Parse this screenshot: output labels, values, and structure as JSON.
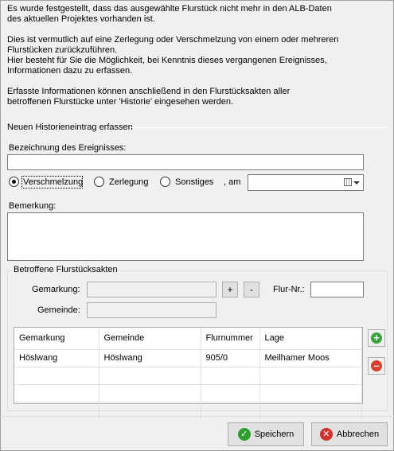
{
  "intro": {
    "paragraph1": "Es wurde festgestellt, dass das ausgewählte Flurstück nicht mehr in den ALB-Daten\ndes aktuellen Projektes vorhanden ist.",
    "paragraph2": "Dies ist vermutlich auf eine Zerlegung oder Verschmelzung von einem oder mehreren\nFlurstücken zurückzuführen.\nHier besteht für Sie die Möglichkeit, bei Kenntnis dieses vergangenen Ereignisses,\nInformationen dazu zu erfassen.",
    "paragraph3": "Erfasste Informationen können anschließend in den Flurstücksakten aller\nbetroffenen Flurstücke unter 'Historie' eingesehen werden."
  },
  "section_title": "Neuen Historieneintrag erfassen",
  "event": {
    "label": "Bezeichnung des Ereignisses:",
    "value": ""
  },
  "event_type": {
    "options": [
      "Verschmelzung",
      "Zerlegung",
      "Sonstiges"
    ],
    "selected": "Verschmelzung",
    "date_label": ", am",
    "date_value": ""
  },
  "remark": {
    "label": "Bemerkung:",
    "value": ""
  },
  "affected": {
    "title": "Betroffene Flurstücksakten",
    "gemarkung_label": "Gemarkung:",
    "gemarkung_value": "",
    "gemeinde_label": "Gemeinde:",
    "gemeinde_value": "",
    "plus_label": "+",
    "minus_label": "-",
    "flurnr_label": "Flur-Nr.:",
    "flurnr_value": "",
    "columns": [
      "Gemarkung",
      "Gemeinde",
      "Flurnummer",
      "Lage"
    ],
    "rows": [
      [
        "Höslwang",
        "Höslwang",
        "905/0",
        "Meilhamer Moos"
      ]
    ],
    "add_icon": "plus-circle-icon",
    "remove_icon": "minus-circle-icon"
  },
  "footer": {
    "save_label": "Speichern",
    "save_icon": "check-circle-icon",
    "cancel_label": "Abbrechen",
    "cancel_icon": "x-circle-icon"
  },
  "colors": {
    "add_green": "#3aa23a",
    "remove_red": "#d9412c",
    "save_green": "#2e9e2e",
    "cancel_red": "#d22f2f"
  }
}
